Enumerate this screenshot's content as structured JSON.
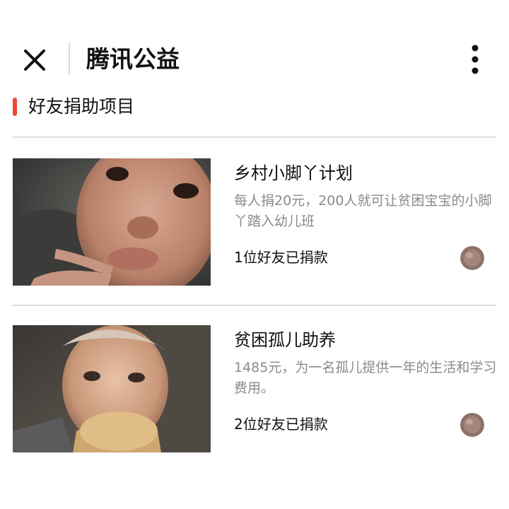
{
  "header": {
    "close_icon": "close-icon",
    "title": "腾讯公益",
    "more_icon": "more-vertical-icon"
  },
  "section": {
    "title": "好友捐助项目",
    "marker_color": "#f0453a"
  },
  "projects": [
    {
      "title": "乡村小脚丫计划",
      "description": "每人捐20元，200人就可让贫困宝宝的小脚丫踏入幼儿班",
      "friends": "1位好友已捐款",
      "image": "child-photo",
      "avatar": "friend-avatar"
    },
    {
      "title": "贫困孤儿助养",
      "description": "1485元，为一名孤儿提供一年的生活和学习费用。",
      "friends": "2位好友已捐款",
      "image": "child-photo",
      "avatar": "friend-avatar"
    }
  ]
}
